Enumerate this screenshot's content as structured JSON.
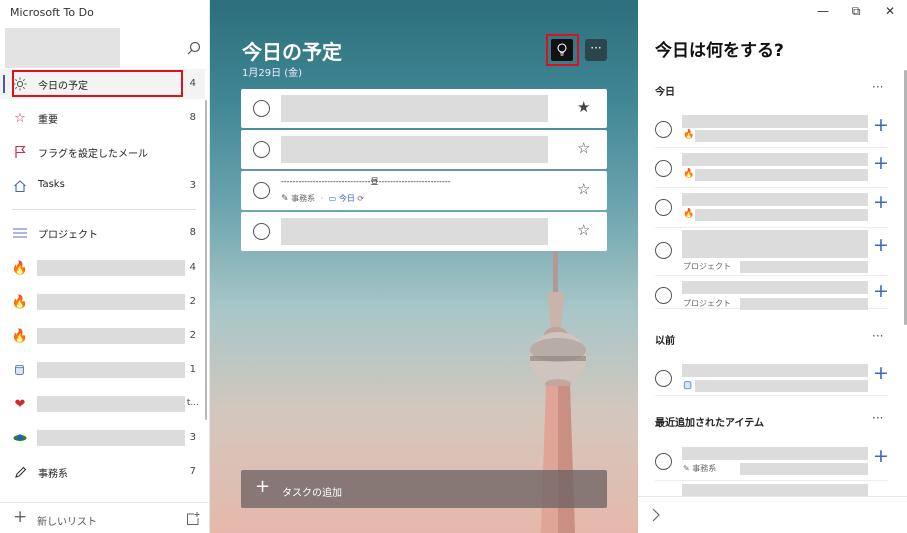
{
  "app": {
    "title": "Microsoft To Do"
  },
  "sidebar": {
    "items": [
      {
        "label": "今日の予定",
        "count": "4"
      },
      {
        "label": "重要",
        "count": "8"
      },
      {
        "label": "フラグを設定したメール",
        "count": ""
      },
      {
        "label": "Tasks",
        "count": "3"
      },
      {
        "label": "プロジェクト",
        "count": "8"
      },
      {
        "label": "",
        "count": "4"
      },
      {
        "label": "",
        "count": "2"
      },
      {
        "label": "",
        "count": "2"
      },
      {
        "label": "",
        "count": "1"
      },
      {
        "label": "",
        "count": ""
      },
      {
        "label": "",
        "count": "3"
      },
      {
        "label": "事務系",
        "count": "7"
      }
    ],
    "new_list_label": "新しいリスト",
    "truncated_tail": "t..."
  },
  "main": {
    "title": "今日の予定",
    "date": "1月29日 (金)",
    "tasks": [
      {
        "title": "",
        "starred": "★"
      },
      {
        "title": "",
        "starred": "☆"
      },
      {
        "title": "-------------------------------昼-------------------------",
        "list": "事務系",
        "due": "今日",
        "starred": "☆"
      },
      {
        "title": "",
        "starred": "☆"
      }
    ],
    "add_task_label": "タスクの追加"
  },
  "panel": {
    "title": "今日は何をする?",
    "sections": [
      {
        "heading": "今日"
      },
      {
        "heading": "以前"
      },
      {
        "heading": "最近追加されたアイテム"
      }
    ],
    "suggestions": [
      {
        "sub": ""
      },
      {
        "sub": ""
      },
      {
        "sub": ""
      },
      {
        "sub": "プロジェクト"
      },
      {
        "sub": "プロジェクト"
      },
      {
        "sub": ""
      },
      {
        "sub": "事務系"
      }
    ]
  },
  "colors": {
    "accent": "#3b67c2",
    "highlight": "#d9121e",
    "nav_marker": "#4a5aa8"
  }
}
